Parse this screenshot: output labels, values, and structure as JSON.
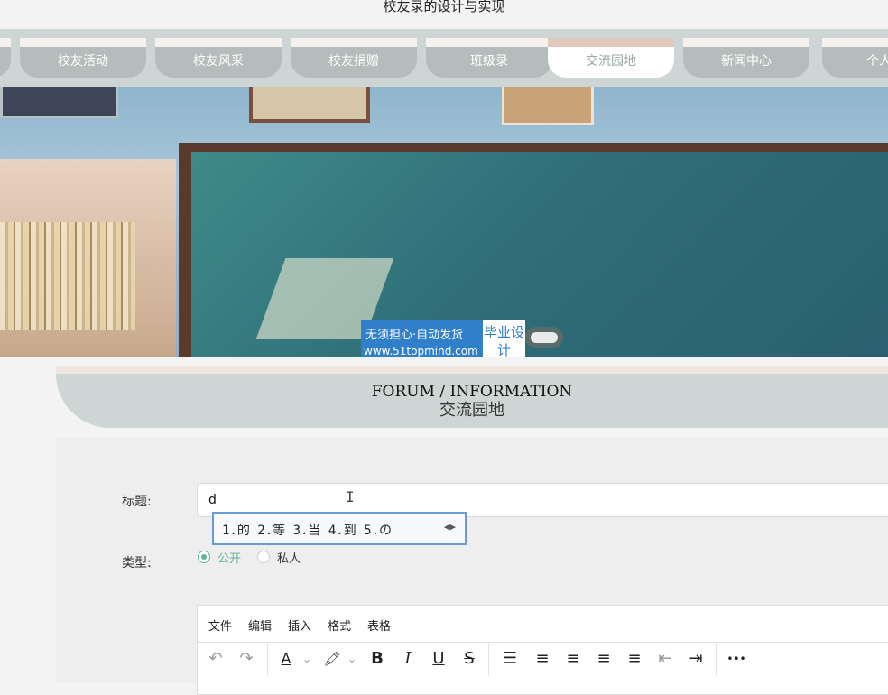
{
  "site": {
    "title": "校友录的设计与实现"
  },
  "nav": {
    "tabs": [
      {
        "label": "校友活动"
      },
      {
        "label": "校友风采"
      },
      {
        "label": "校友捐赠"
      },
      {
        "label": "班级录"
      },
      {
        "label": "交流园地",
        "active": true
      },
      {
        "label": "新闻中心"
      },
      {
        "label": "个人中"
      }
    ]
  },
  "banner": {
    "watermark_line1": "无须担心·自动发货",
    "watermark_line2": "www.51topmind.com",
    "watermark_badge": "毕业设计"
  },
  "section": {
    "title_en": "FORUM / INFORMATION",
    "title_cn": "交流园地"
  },
  "form": {
    "title_label": "标题:",
    "title_value": "d",
    "type_label": "类型:",
    "type_options": [
      {
        "label": "公开",
        "checked": true
      },
      {
        "label": "私人",
        "checked": false
      }
    ]
  },
  "ime": {
    "candidates": "1.的 2.等 3.当 4.到 5.の",
    "arrows": "◀▶"
  },
  "editor": {
    "menu": [
      "文件",
      "编辑",
      "插入",
      "格式",
      "表格"
    ],
    "toolbar": {
      "undo": "↶",
      "redo": "↷",
      "font_color": "A",
      "caret": "⌄",
      "highlight": "🖍",
      "bold": "B",
      "italic": "I",
      "underline": "U",
      "strike": "S",
      "line_height": "☰",
      "align_left": "≡",
      "align_center": "≡",
      "align_right": "≡",
      "justify": "≡",
      "outdent": "⇤",
      "indent": "⇥",
      "more": "•••"
    }
  },
  "colors": {
    "nav_bg": "#cdd6d4",
    "tab_bg": "#b4bdbb",
    "tab_active_text": "#9ba8a6",
    "accent_radio": "#5fb49c",
    "ime_border": "#6a9bd8",
    "watermark_blue": "#2f7fc9"
  }
}
